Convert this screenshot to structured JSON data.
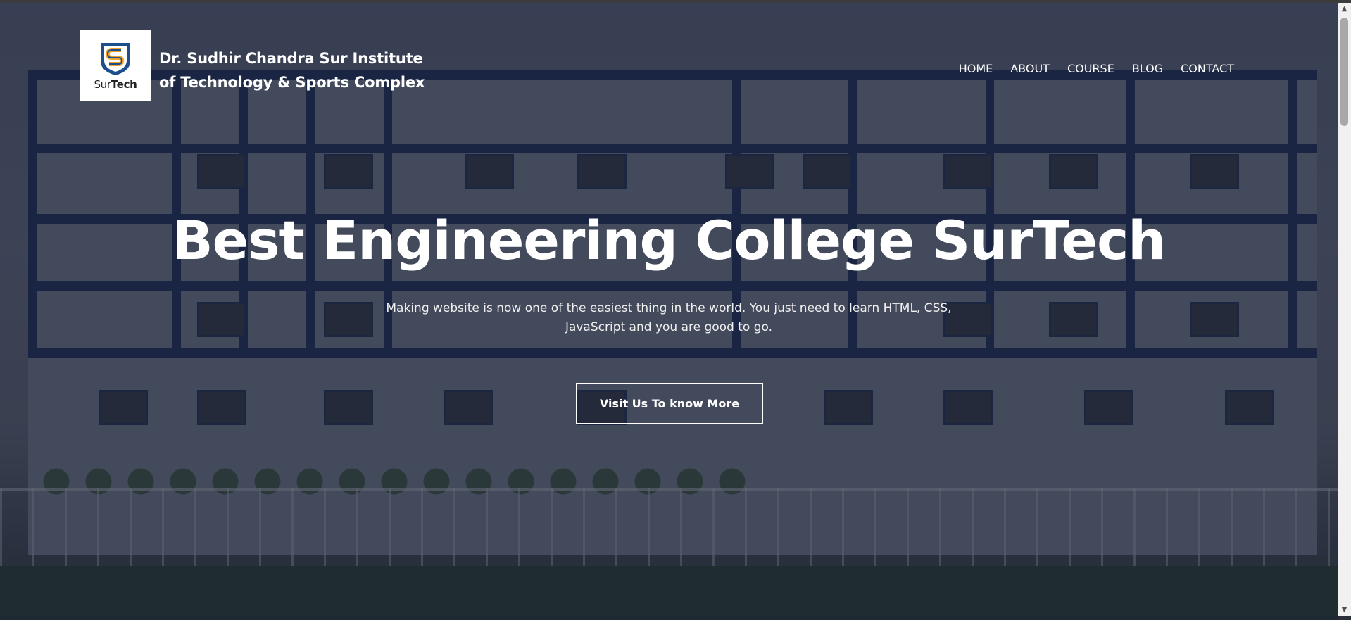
{
  "header": {
    "logo_text_regular": "Sur",
    "logo_text_bold": "Tech",
    "brand_line1": "Dr. Sudhir Chandra Sur Institute",
    "brand_line2": "of Technology & Sports Complex",
    "nav": [
      {
        "label": "HOME"
      },
      {
        "label": "ABOUT"
      },
      {
        "label": "COURSE"
      },
      {
        "label": "BLOG"
      },
      {
        "label": "CONTACT"
      }
    ]
  },
  "hero": {
    "title": "Best Engineering College SurTech",
    "subtitle_line1": "Making website is now one of the easiest thing in the world. You just need to learn HTML, CSS,",
    "subtitle_line2": "JavaScript and you are good to go.",
    "cta_label": "Visit Us To know More"
  },
  "colors": {
    "overlay": "#161b2d",
    "logo_blue": "#1f4e8c",
    "logo_orange": "#f0a32a"
  },
  "icons": {
    "logo": "shield-s-logo-icon",
    "scroll_up": "triangle-up-icon",
    "scroll_down": "triangle-down-icon"
  }
}
